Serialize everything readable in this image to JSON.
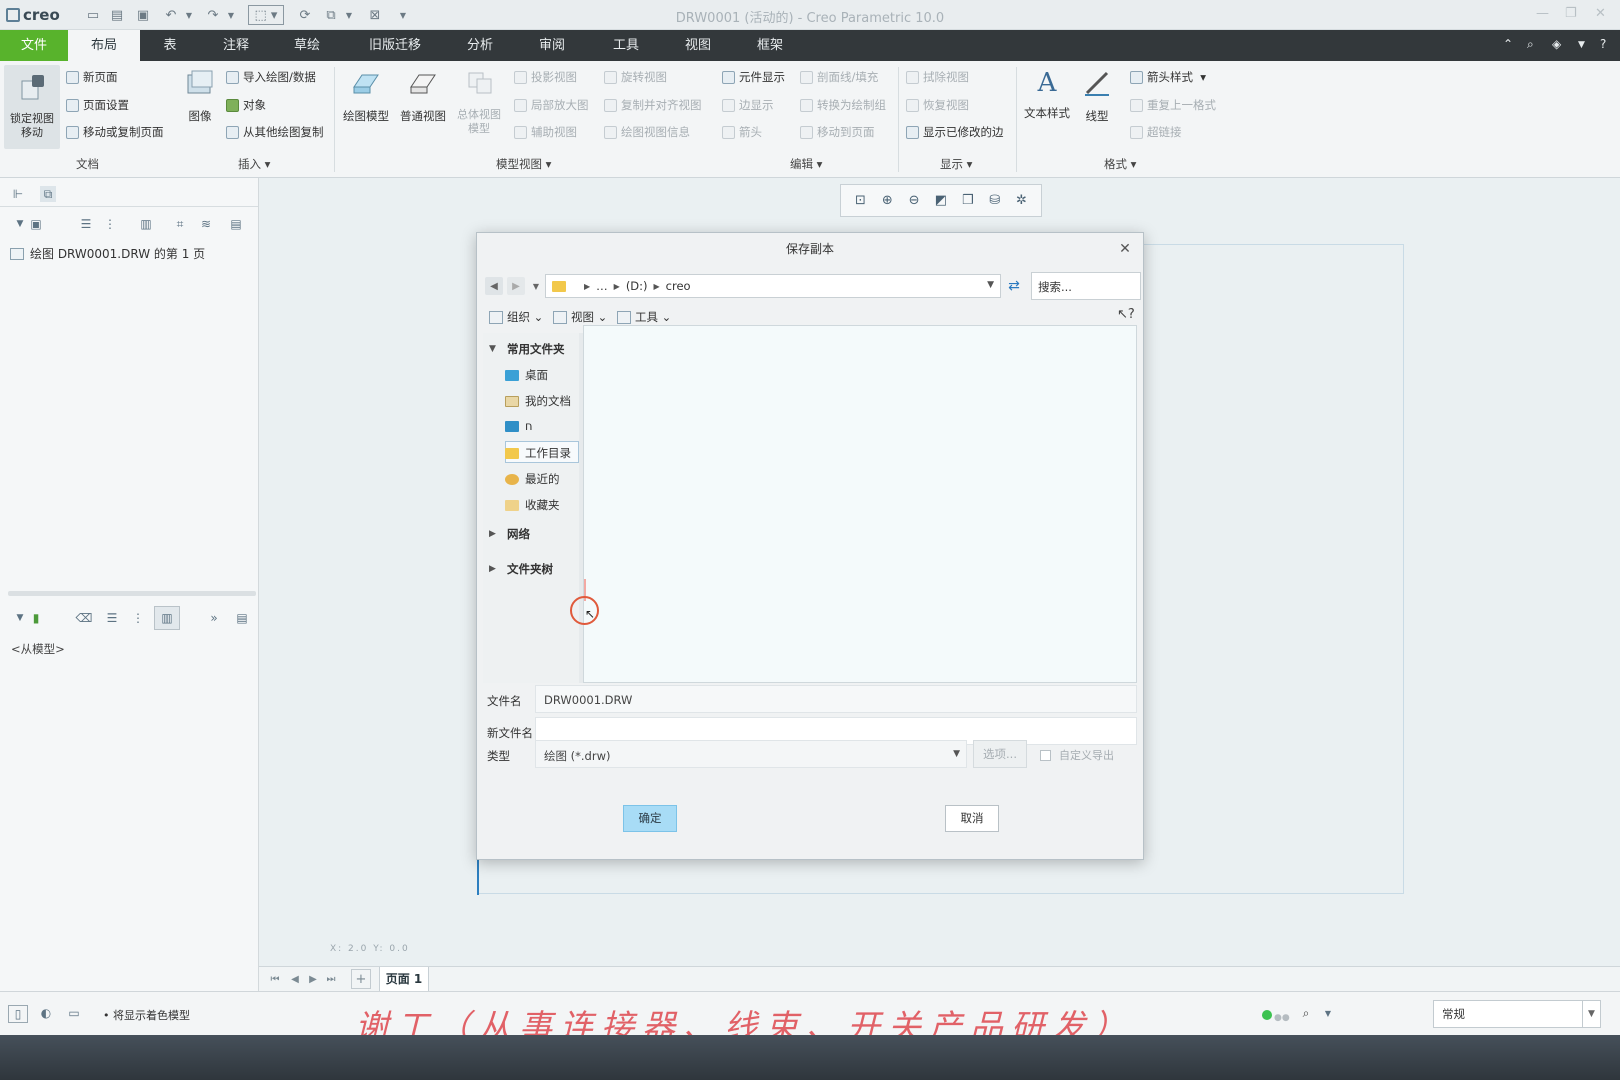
{
  "app": {
    "logo": "creo",
    "window_title": "DRW0001 (活动的) - Creo Parametric 10.0"
  },
  "menu_tabs": [
    "文件",
    "布局",
    "表",
    "注释",
    "草绘",
    "旧版迁移",
    "分析",
    "审阅",
    "工具",
    "视图",
    "框架"
  ],
  "active_tab": "布局",
  "ribbon": {
    "doc": {
      "lock_label": "锁定视图\n移动",
      "new_page": "新页面",
      "page_setup": "页面设置",
      "move_copy": "移动或复制页面",
      "label": "文档"
    },
    "insert": {
      "image": "图像",
      "import": "导入绘图/数据",
      "object": "对象",
      "copy_from": "从其他绘图复制",
      "label": "插入"
    },
    "model_views": {
      "drawing_model": "绘图模型",
      "general_view": "普通视图",
      "overview": "总体视图\n模型",
      "projection": "投影视图",
      "revolved": "旋转视图",
      "detailed": "局部放大图",
      "copy_align": "复制并对齐视图",
      "auxiliary": "辅助视图",
      "drawing_info": "绘图视图信息",
      "label": "模型视图"
    },
    "edit": {
      "element_display": "元件显示",
      "hatching": "剖面线/填充",
      "edge_display": "边显示",
      "convert_draft": "转换为绘制组",
      "arrows": "箭头",
      "move_to_page": "移动到页面",
      "label": "编辑"
    },
    "display": {
      "erase_view": "拭除视图",
      "resume_view": "恢复视图",
      "show_modified": "显示已修改的边",
      "label": "显示"
    },
    "format": {
      "text_style": "文本样式",
      "line_style": "线型",
      "arrow_style": "箭头样式",
      "repeat": "重复上一格式",
      "hyperlink": "超链接",
      "label": "格式"
    }
  },
  "left_panel": {
    "tree_item": "绘图 DRW0001.DRW 的第 1 页",
    "model_placeholder": "<从模型>"
  },
  "dialog": {
    "title": "保存副本",
    "path": [
      "…",
      "(D:)",
      "creo"
    ],
    "search_placeholder": "搜索...",
    "toolbar": {
      "organize": "组织",
      "views": "视图",
      "tools": "工具"
    },
    "common_folders": "常用文件夹",
    "folders": [
      "桌面",
      "我的文档",
      "ח",
      "工作目录",
      "最近的",
      "收藏夹"
    ],
    "network": "网络",
    "folder_tree": "文件夹树",
    "file_name_label": "文件名",
    "file_name": "DRW0001.DRW",
    "new_name_label": "新文件名",
    "new_name": "",
    "type_label": "类型",
    "type_value": "绘图 (*.drw)",
    "options": "选项...",
    "custom_export": "自定义导出",
    "ok": "确定",
    "cancel": "取消"
  },
  "page_tab": "页面 1",
  "status": {
    "message": "• 将显示着色模型",
    "filter": "常规"
  },
  "coords_text": "X: 2.0  Y: 0.0",
  "watermark": "谢工（从事连接器、线束、开关产品研发）"
}
